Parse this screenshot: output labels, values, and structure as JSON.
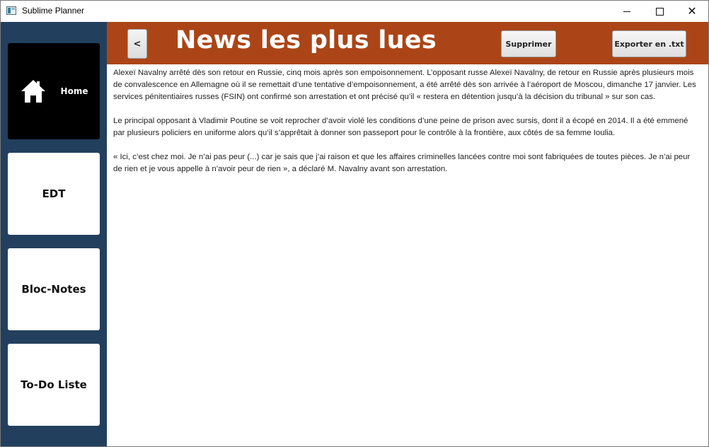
{
  "window": {
    "title": "Sublime Planner",
    "controls": {
      "minimize": "minimize-icon",
      "maximize": "maximize-icon",
      "close": "close-icon"
    }
  },
  "sidebar": {
    "items": [
      {
        "label": "Home",
        "icon": "home-icon",
        "active": true
      },
      {
        "label": "EDT"
      },
      {
        "label": "Bloc-Notes"
      },
      {
        "label": "To-Do Liste"
      }
    ]
  },
  "header": {
    "back_label": "<",
    "title": "News les plus lues",
    "delete_label": "Supprimer",
    "export_label": "Exporter en .txt"
  },
  "article": {
    "paragraphs": [
      "Alexeï Navalny arrêté dès son retour en Russie, cinq mois après son empoisonnement. L’opposant russe Alexeï Navalny, de retour en Russie après plusieurs mois de convalescence en Allemagne où il se remettait d’une tentative d’empoisonnement, a été arrêté dès son arrivée à l’aéroport de Moscou, dimanche 17 janvier. Les services pénitentiaires russes (FSIN) ont confirmé son arrestation et ont précisé qu’il « restera en détention jusqu’à la décision du tribunal » sur son cas.",
      "Le principal opposant à Vladimir Poutine se voit reprocher d’avoir violé les conditions d’une peine de prison avec sursis, dont il a écopé en 2014. Il a été emmené par plusieurs policiers en uniforme alors qu’il s’apprêtait à donner son passeport pour le contrôle à la frontière, aux côtés de sa femme Ioulia.",
      "« Ici, c’est chez moi. Je n’ai pas peur (...) car je sais que j’ai raison et que les affaires criminelles lancées contre moi sont fabriquées de toutes pièces. Je n’ai peur de rien et je vous appelle à n’avoir peur de rien », a déclaré M. Navalny avant son arrestation."
    ]
  },
  "colors": {
    "sidebar_bg": "#22405e",
    "header_bg": "#ab4517",
    "home_card_bg": "#000000",
    "card_bg": "#ffffff"
  }
}
